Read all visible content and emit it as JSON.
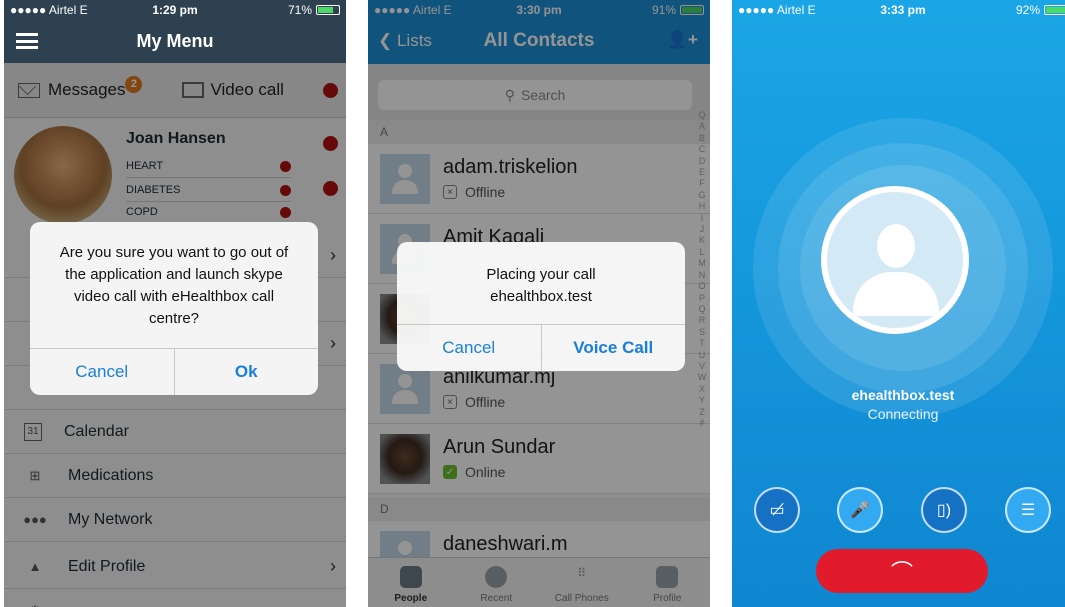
{
  "panel1": {
    "status": {
      "carrier": "●●●●● Airtel  E",
      "time": "1:29 pm",
      "battery": "71%"
    },
    "title": "My Menu",
    "messages_label": "Messages",
    "messages_badge": "2",
    "video_call_label": "Video call",
    "user_name": "Joan Hansen",
    "conditions": [
      "HEART",
      "DIABETES",
      "COPD"
    ],
    "menu": [
      "Calendar",
      "Medications",
      "My Network",
      "Edit Profile"
    ],
    "calendar_day": "31",
    "alert": {
      "message": "Are you sure you want to go out of the application and launch skype video call with eHealthbox call centre?",
      "cancel": "Cancel",
      "ok": "Ok"
    }
  },
  "panel2": {
    "status": {
      "carrier": "●●●●● Airtel  E",
      "time": "3:30 pm",
      "battery": "91%"
    },
    "back_label": "Lists",
    "title": "All Contacts",
    "search_placeholder": "Search",
    "sections": [
      "A",
      "D"
    ],
    "contacts": [
      {
        "name": "adam.triskelion",
        "status": "Offline"
      },
      {
        "name": "Amit Kagali",
        "status": ""
      },
      {
        "name": "anilkumar.mj",
        "status": "Offline"
      },
      {
        "name": "Arun Sundar",
        "status": "Online"
      },
      {
        "name": "daneshwari.m",
        "status": ""
      }
    ],
    "alphabet": [
      "Q",
      "A",
      "B",
      "C",
      "D",
      "E",
      "F",
      "G",
      "H",
      "I",
      "J",
      "K",
      "L",
      "M",
      "N",
      "O",
      "P",
      "Q",
      "R",
      "S",
      "T",
      "U",
      "V",
      "W",
      "X",
      "Y",
      "Z",
      "#"
    ],
    "tabs": [
      "People",
      "Recent",
      "Call Phones",
      "Profile"
    ],
    "alert": {
      "message_line1": "Placing your call",
      "message_line2": "ehealthbox.test",
      "cancel": "Cancel",
      "voice_call": "Voice Call"
    }
  },
  "panel3": {
    "status": {
      "carrier": "●●●●● Airtel  E",
      "time": "3:33 pm",
      "battery": "92%"
    },
    "callee": "ehealthbox.test",
    "call_status": "Connecting"
  }
}
